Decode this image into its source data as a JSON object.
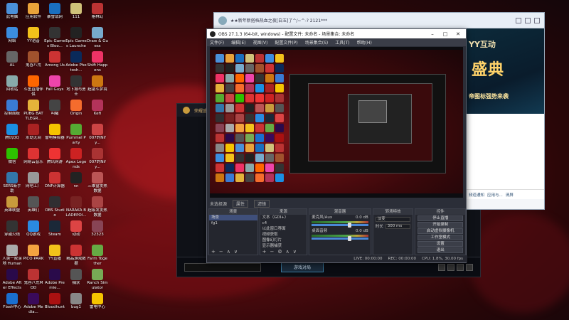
{
  "desktop": {
    "icons": [
      {
        "label": "此电脑",
        "color": "#4a90d9"
      },
      {
        "label": "应用软件",
        "color": "#e9a33a"
      },
      {
        "label": "暴雪战网",
        "color": "#1a6fbf"
      },
      {
        "label": "111",
        "color": "#d0c27a"
      },
      {
        "label": "格林幻",
        "color": "#b33"
      },
      {
        "label": "网络",
        "color": "#3b8de0"
      },
      {
        "label": "YY语音",
        "color": "#f2c21a"
      },
      {
        "label": "Epic Games Bloo...",
        "color": "#333"
      },
      {
        "label": "Epic Games Launcher",
        "color": "#222"
      },
      {
        "label": "Draw & Guess",
        "color": "#7ac"
      },
      {
        "label": "AL",
        "color": "#666"
      },
      {
        "label": "鬼谷八荒",
        "color": "#a0522d"
      },
      {
        "label": "Among Us",
        "color": "#c33"
      },
      {
        "label": "Adobe Photosh...",
        "color": "#0a2a5a"
      },
      {
        "label": "Shift Happens",
        "color": "#e36"
      },
      {
        "label": "回收站",
        "color": "#8aa"
      },
      {
        "label": "斗鱼直播伴侣",
        "color": "#f60"
      },
      {
        "label": "Fall Guys",
        "color": "#e4a"
      },
      {
        "label": "地下城与勇士",
        "color": "#333"
      },
      {
        "label": "超激斗梦境",
        "color": "#c71"
      },
      {
        "label": "控制面板",
        "color": "#3a7bd5"
      },
      {
        "label": "PUBG BATTLEGR...",
        "color": "#e4b23a"
      },
      {
        "label": "叫醒",
        "color": "#444"
      },
      {
        "label": "Origin",
        "color": "#f56c2d"
      },
      {
        "label": "Kefi",
        "color": "#b3335a"
      },
      {
        "label": "腾讯QQ",
        "color": "#1a8fe3"
      },
      {
        "label": "永劫无间",
        "color": "#a22"
      },
      {
        "label": "雷电模拟器",
        "color": "#f5c400"
      },
      {
        "label": "Pummel Party",
        "color": "#5a3"
      },
      {
        "label": "007的Nify...",
        "color": "#c44"
      },
      {
        "label": "微信",
        "color": "#2dc100"
      },
      {
        "label": "网易云音乐",
        "color": "#d33"
      },
      {
        "label": "腾讯网游",
        "color": "#e33"
      },
      {
        "label": "Apex Legends",
        "color": "#c22"
      },
      {
        "label": "007的Nify...",
        "color": "#a33"
      },
      {
        "label": "SERS新手助",
        "color": "#37a"
      },
      {
        "label": "网吧工厂",
        "color": "#999"
      },
      {
        "label": "DNF计算器",
        "color": "#c33"
      },
      {
        "label": "nn",
        "color": "#222"
      },
      {
        "label": "三维盒发热数据",
        "color": "#b55"
      },
      {
        "label": "英雄联盟",
        "color": "#c89b3c"
      },
      {
        "label": "英雄们",
        "color": "#555"
      },
      {
        "label": "OBS Studio",
        "color": "#302e31"
      },
      {
        "label": "NARAKA BLADEPOI...",
        "color": "#722"
      },
      {
        "label": "超级发发热数据",
        "color": "#a44"
      },
      {
        "label": "穿越火线",
        "color": "#333"
      },
      {
        "label": "QQ游戏",
        "color": "#2a8ae0"
      },
      {
        "label": "Steam",
        "color": "#1b2838"
      },
      {
        "label": "动动",
        "color": "#d44"
      },
      {
        "label": "32323",
        "color": "#845"
      },
      {
        "label": "人类一败涂地 Human Fa...",
        "color": "#aaa"
      },
      {
        "label": "PICO PARK",
        "color": "#f4a340"
      },
      {
        "label": "YY直播",
        "color": "#f2c21a"
      },
      {
        "label": "精品游戏数据",
        "color": "#c33"
      },
      {
        "label": "Farm Together",
        "color": "#6a4"
      },
      {
        "label": "Adobe After Effects 2019",
        "color": "#2a0a4a"
      },
      {
        "label": "鬼谷八荒MOD",
        "color": "#b33"
      },
      {
        "label": "Adobe Premie...",
        "color": "#2a0a4a"
      },
      {
        "label": "捕获",
        "color": "#555"
      },
      {
        "label": "Ranch Simulator",
        "color": "#7a5"
      },
      {
        "label": "Flash中心",
        "color": "#1a6fd0"
      },
      {
        "label": "Adobe Media...",
        "color": "#3a0a5a"
      },
      {
        "label": "Bloodhunt",
        "color": "#a11"
      },
      {
        "label": "bug1",
        "color": "#888"
      },
      {
        "label": "雷电中心",
        "color": "#f5c400"
      }
    ]
  },
  "obs": {
    "title": "OBS 27.1.3 (64-bit, windows) - 配置文件: 未命名 - 场景集合: 未命名",
    "menu": [
      "文件(F)",
      "编辑(E)",
      "视图(V)",
      "配置文件(P)",
      "场景集合(S)",
      "工具(T)",
      "帮助(H)"
    ],
    "no_source": "未选择源",
    "props_btn": "属性",
    "filters_btn": "滤镜",
    "docks": {
      "scenes": {
        "title": "场景",
        "items": [
          "场景",
          "fg1"
        ]
      },
      "sources": {
        "title": "来源",
        "items": [
          "文本（GDI+）",
          "c4",
          "以此窗口界面",
          "视频获取",
          "图像幻灯片",
          "显示器捕获"
        ]
      },
      "mixer": {
        "title": "混音器",
        "tracks": [
          {
            "name": "麦克风/Aux",
            "db": "0.0 dB"
          },
          {
            "name": "桌面音频",
            "db": "0.0 dB"
          }
        ]
      },
      "transitions": {
        "title": "转场特效",
        "type": "淡变",
        "duration_label": "时长",
        "duration": "300 ms"
      },
      "controls": {
        "title": "控件",
        "buttons": [
          "停止直播",
          "开始录制",
          "启动虚拟摄像机",
          "工作室模式",
          "设置",
          "退出"
        ]
      }
    },
    "status": [
      "LIVE: 00:00:00",
      "REC: 00:00:00",
      "CPU: 1.8%, 30.00 fps"
    ]
  },
  "browser": {
    "title": "★★新年新搭档热血之夜[白玉]了^/~^-? 2121***",
    "banner_tag": "YY互动",
    "banner_big": "盛典",
    "banner_sub": "帝图标强势来袭",
    "chat_foot": [
      "频道通知",
      "应用与...",
      "清屏"
    ]
  },
  "launcher": {
    "header": "荣耀盛典",
    "play_button": "游戏对局"
  }
}
